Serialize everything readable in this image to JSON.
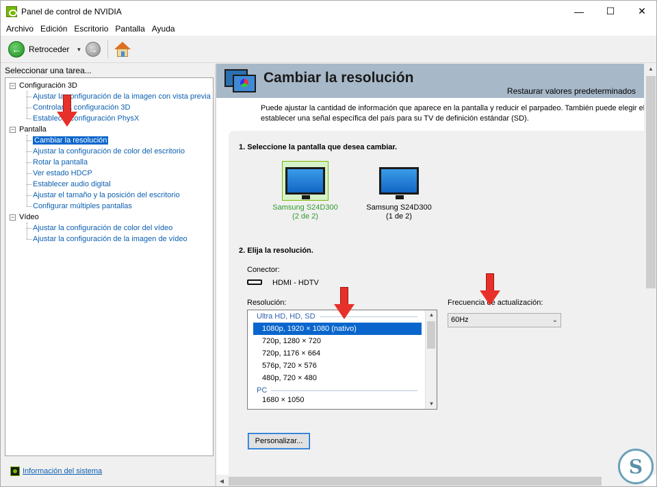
{
  "window": {
    "title": "Panel de control de NVIDIA",
    "controls": {
      "minimize": "—",
      "maximize": "☐",
      "close": "✕"
    }
  },
  "menu": [
    "Archivo",
    "Edición",
    "Escritorio",
    "Pantalla",
    "Ayuda"
  ],
  "toolbar": {
    "back_label": "Retroceder",
    "icons": [
      "back-arrow-icon",
      "dropdown-icon",
      "forward-arrow-icon",
      "home-icon"
    ]
  },
  "sidebar": {
    "header": "Seleccionar una tarea...",
    "categories": [
      {
        "label": "Configuración 3D",
        "items": [
          "Ajustar la configuración de la imagen con vista previa",
          "Controlar la configuración 3D",
          "Establecer configuración PhysX"
        ]
      },
      {
        "label": "Pantalla",
        "items": [
          "Cambiar la resolución",
          "Ajustar la configuración de color del escritorio",
          "Rotar la pantalla",
          "Ver estado HDCP",
          "Establecer audio digital",
          "Ajustar el tamaño y la posición del escritorio",
          "Configurar múltiples pantallas"
        ]
      },
      {
        "label": "Vídeo",
        "items": [
          "Ajustar la configuración de color del vídeo",
          "Ajustar la configuración de la imagen de vídeo"
        ]
      }
    ],
    "selected_item": "Cambiar la resolución",
    "footer_link": "Información del sistema"
  },
  "main": {
    "title": "Cambiar la resolución",
    "restore_link": "Restaurar valores predeterminados",
    "intro_line1": "Puede ajustar la cantidad de información que aparece en la pantalla y reducir el parpadeo. También puede elegir el formato",
    "intro_line2": "establecer una señal específica del país para su TV de definición estándar (SD).",
    "step1": "1. Seleccione la pantalla que desea cambiar.",
    "monitors": [
      {
        "name": "Samsung S24D300",
        "index": "(2 de 2)",
        "selected": true
      },
      {
        "name": "Samsung S24D300",
        "index": "(1 de 2)",
        "selected": false
      }
    ],
    "step2": "2. Elija la resolución.",
    "connector_label": "Conector:",
    "connector_value": "HDMI - HDTV",
    "resolution_label": "Resolución:",
    "resolution_groups": [
      {
        "name": "Ultra HD, HD, SD",
        "items": [
          "1080p, 1920 × 1080 (nativo)",
          "720p, 1280 × 720",
          "720p, 1176 × 664",
          "576p, 720 × 576",
          "480p, 720 × 480"
        ]
      },
      {
        "name": "PC",
        "items": [
          "1680 × 1050"
        ]
      }
    ],
    "selected_resolution": "1080p, 1920 × 1080 (nativo)",
    "refresh_label": "Frecuencia de actualización:",
    "refresh_value": "60Hz",
    "customize_button": "Personalizar...",
    "colors": {
      "nvidia_green": "#76b900",
      "selection_blue": "#0a66cc",
      "banner": "#a7b8c8",
      "annotation_red": "#e8302a"
    }
  },
  "watermark": {
    "letter": "S"
  }
}
